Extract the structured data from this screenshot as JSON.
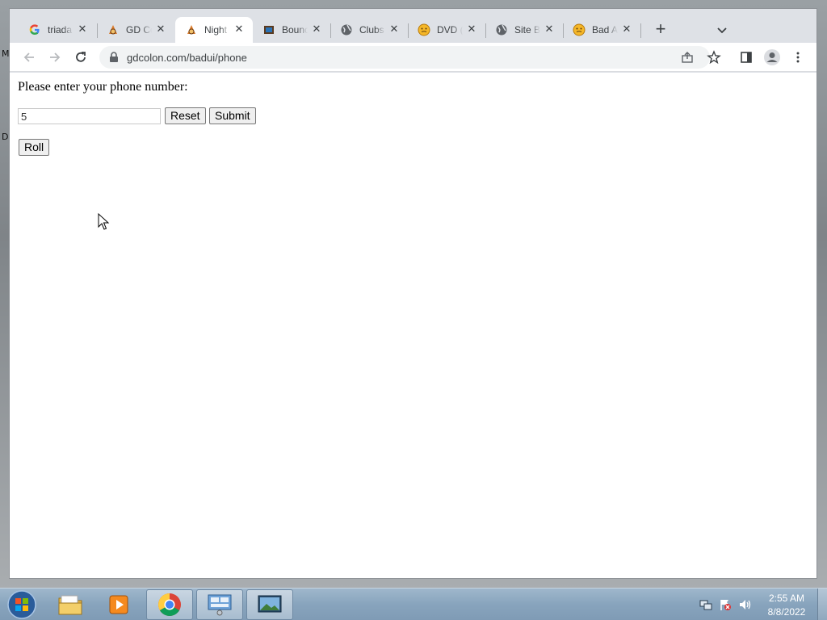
{
  "desktop": {
    "side_letters": [
      "M",
      "D"
    ]
  },
  "browser": {
    "tabs": [
      {
        "title": "triada",
        "favicon": "google-icon"
      },
      {
        "title": "GD Co",
        "favicon": "gdcolon-icon"
      },
      {
        "title": "Night",
        "favicon": "gdcolon-icon",
        "active": true
      },
      {
        "title": "Bounc",
        "favicon": "bounce-game-icon"
      },
      {
        "title": "Clubs",
        "favicon": "globe-icon"
      },
      {
        "title": "DVD (",
        "favicon": "emoji-face-icon"
      },
      {
        "title": "Site B",
        "favicon": "globe-icon"
      },
      {
        "title": "Bad A",
        "favicon": "emoji-face-icon"
      }
    ],
    "close_glyph": "✕",
    "new_tab_glyph": "+",
    "url": "gdcolon.com/badui/phone"
  },
  "page": {
    "prompt": "Please enter your phone number:",
    "phone_value": "5",
    "reset_label": "Reset",
    "submit_label": "Submit",
    "roll_label": "Roll"
  },
  "taskbar": {
    "apps": [
      "start-orb-icon",
      "file-explorer-icon",
      "media-player-icon",
      "chrome-icon",
      "control-panel-icon",
      "remote-desktop-icon"
    ],
    "time": "2:55 AM",
    "date": "8/8/2022"
  },
  "colors": {
    "tab_strip": "#dee1e6",
    "taskbar": "#88a4bd",
    "page_bg": "#ffffff"
  }
}
